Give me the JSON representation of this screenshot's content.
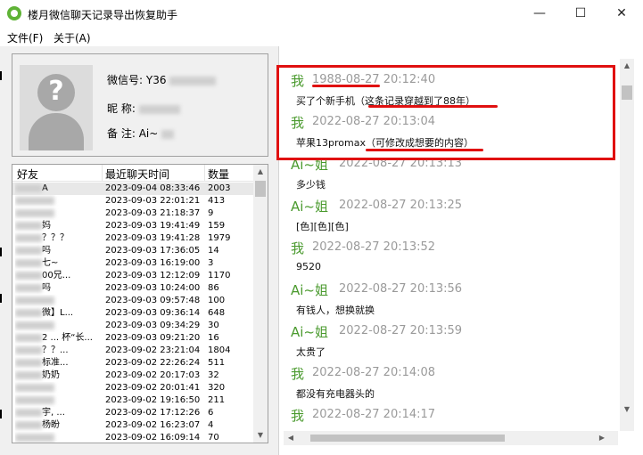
{
  "window": {
    "title": "楼月微信聊天记录导出恢复助手",
    "minimize": "—",
    "maximize": "☐",
    "close": "✕"
  },
  "menu": {
    "file": "文件(F)",
    "about": "关于(A)"
  },
  "profile": {
    "wechat_id_label": "微信号:",
    "wechat_id_value": "Y36",
    "nickname_label": "昵  称:",
    "remark_label": "备  注:",
    "remark_value": "Ai~"
  },
  "friends": {
    "headers": {
      "name": "好友",
      "time": "最近聊天时间",
      "count": "数量"
    },
    "rows": [
      {
        "name": "A",
        "time": "2023-09-04 08:33:46",
        "count": "2003"
      },
      {
        "name": "",
        "time": "2023-09-03 22:01:21",
        "count": "413"
      },
      {
        "name": "",
        "time": "2023-09-03 21:18:37",
        "count": "9"
      },
      {
        "name": "妈",
        "time": "2023-09-03 19:41:49",
        "count": "159"
      },
      {
        "name": "？？？",
        "time": "2023-09-03 19:41:28",
        "count": "1979"
      },
      {
        "name": "吗",
        "time": "2023-09-03 17:36:05",
        "count": "14"
      },
      {
        "name": "七~",
        "time": "2023-09-03 16:19:00",
        "count": "3"
      },
      {
        "name": "00兄...",
        "time": "2023-09-03 12:12:09",
        "count": "1170"
      },
      {
        "name": "吗",
        "time": "2023-09-03 10:24:00",
        "count": "86"
      },
      {
        "name": "",
        "time": "2023-09-03 09:57:48",
        "count": "100"
      },
      {
        "name": "微】L...",
        "time": "2023-09-03 09:36:14",
        "count": "648"
      },
      {
        "name": "",
        "time": "2023-09-03 09:34:29",
        "count": "30"
      },
      {
        "name": "2 ... 杯“长...",
        "time": "2023-09-03 09:21:20",
        "count": "16"
      },
      {
        "name": "？？...",
        "time": "2023-09-02 23:21:04",
        "count": "1804"
      },
      {
        "name": "标准...",
        "time": "2023-09-02 22:26:24",
        "count": "511"
      },
      {
        "name": "奶奶",
        "time": "2023-09-02 20:17:03",
        "count": "32"
      },
      {
        "name": "",
        "time": "2023-09-02 20:01:41",
        "count": "320"
      },
      {
        "name": "",
        "time": "2023-09-02 19:16:50",
        "count": "211"
      },
      {
        "name": "宇, ...",
        "time": "2023-09-02 17:12:26",
        "count": "6"
      },
      {
        "name": "杨盼",
        "time": "2023-09-02 16:23:07",
        "count": "4"
      },
      {
        "name": "",
        "time": "2023-09-02 16:09:14",
        "count": "70"
      }
    ]
  },
  "messages": [
    {
      "sender": "我",
      "time": "20:12:40",
      "time_date": "1988-08-27",
      "text": "买了个新手机（这条记录穿越到了88年）"
    },
    {
      "sender": "我",
      "time": "2022-08-27 20:13:04",
      "time_date": "",
      "text": "苹果13promax（可修改成想要的内容）"
    },
    {
      "sender": "Ai~姐",
      "time": "2022-08-27 20:13:13",
      "time_date": "",
      "text": "多少钱"
    },
    {
      "sender": "Ai~姐",
      "time": "2022-08-27 20:13:25",
      "time_date": "",
      "text": "[色][色][色]"
    },
    {
      "sender": "我",
      "time": "2022-08-27 20:13:52",
      "time_date": "",
      "text": "9520"
    },
    {
      "sender": "Ai~姐",
      "time": "2022-08-27 20:13:56",
      "time_date": "",
      "text": "有钱人，想换就换"
    },
    {
      "sender": "Ai~姐",
      "time": "2022-08-27 20:13:59",
      "time_date": "",
      "text": "太贵了"
    },
    {
      "sender": "我",
      "time": "2022-08-27 20:14:08",
      "time_date": "",
      "text": "都没有充电器头的"
    },
    {
      "sender": "我",
      "time": "2022-08-27 20:14:17",
      "time_date": "",
      "text": ""
    }
  ],
  "colors": {
    "sender": "#4a9a2e",
    "time": "#9a9a9a",
    "highlight": "#e01010"
  }
}
